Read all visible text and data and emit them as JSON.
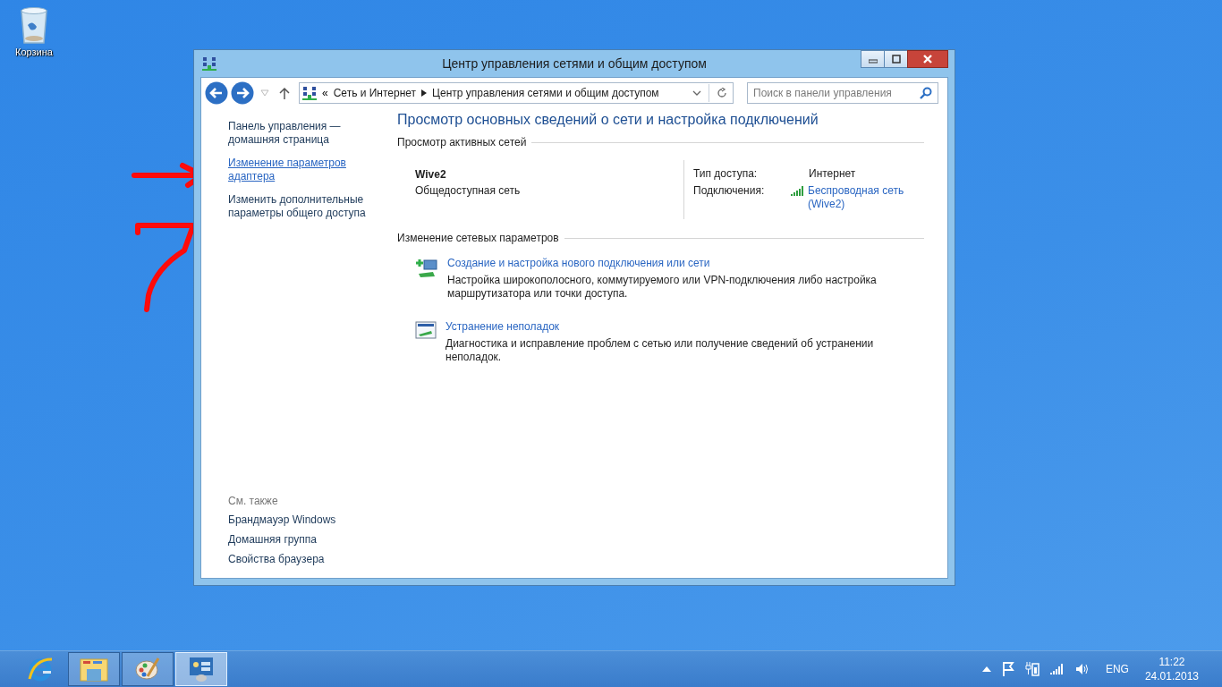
{
  "desktop_icons": [
    {
      "label": "Корзина"
    }
  ],
  "window": {
    "title": "Центр управления сетями и общим доступом"
  },
  "address_bar": {
    "crumbs": [
      "Сеть и Интернет",
      "Центр управления сетями и общим доступом"
    ],
    "overflow": "«",
    "search_placeholder": "Поиск в панели управления"
  },
  "sidebar": {
    "links": [
      {
        "label": "Панель управления — домашняя страница",
        "hovered": false
      },
      {
        "label": "Изменение параметров адаптера",
        "hovered": true
      },
      {
        "label": "Изменить дополнительные параметры общего доступа",
        "hovered": false
      }
    ],
    "see_also_heading": "См. также",
    "see_also": [
      "Брандмауэр Windows",
      "Домашняя группа",
      "Свойства браузера"
    ]
  },
  "main": {
    "heading": "Просмотр основных сведений о сети и настройка подключений",
    "active_networks_heading": "Просмотр активных сетей",
    "network": {
      "name": "Wive2",
      "category": "Общедоступная сеть",
      "access_label": "Тип доступа:",
      "access_value": "Интернет",
      "connections_label": "Подключения:",
      "connection_link": "Беспроводная сеть (Wive2)"
    },
    "change_heading": "Изменение сетевых параметров",
    "tasks": [
      {
        "kind": "new-connection",
        "title": "Создание и настройка нового подключения или сети",
        "description": "Настройка широкополосного, коммутируемого или VPN-подключения либо настройка маршрутизатора или точки доступа."
      },
      {
        "kind": "troubleshoot",
        "title": "Устранение неполадок",
        "description": "Диагностика и исправление проблем с сетью или получение сведений об устранении неполадок."
      }
    ]
  },
  "taskbar": {
    "apps": [
      {
        "kind": "ie",
        "selected": false
      },
      {
        "kind": "explorer",
        "selected": false
      },
      {
        "kind": "paint",
        "selected": false
      },
      {
        "kind": "control-panel",
        "selected": true
      }
    ],
    "language": "ENG",
    "time": "11:22",
    "date": "24.01.2013"
  }
}
